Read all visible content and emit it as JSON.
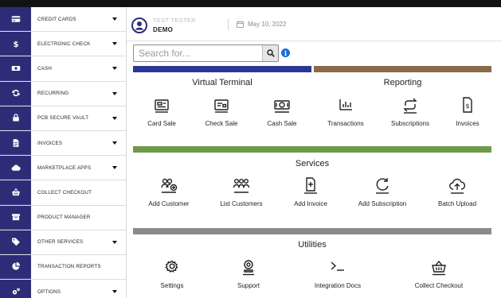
{
  "sidebar": {
    "items": [
      {
        "label": "CREDIT CARDS",
        "icon": "credit-card-icon",
        "caret": true
      },
      {
        "label": "ELECTRONIC CHECK",
        "icon": "dollar-icon",
        "caret": true
      },
      {
        "label": "CASH",
        "icon": "cash-icon",
        "caret": true
      },
      {
        "label": "RECURRING",
        "icon": "recurring-icon",
        "caret": true
      },
      {
        "label": "PCB SECURE VAULT",
        "icon": "lock-icon",
        "caret": true
      },
      {
        "label": "INVOICES",
        "icon": "invoice-icon",
        "caret": true
      },
      {
        "label": "MARKETPLACE APPS",
        "icon": "cloud-icon",
        "caret": true
      },
      {
        "label": "COLLECT CHECKOUT",
        "icon": "basket-icon",
        "caret": false
      },
      {
        "label": "PRODUCT MANAGER",
        "icon": "box-icon",
        "caret": false
      },
      {
        "label": "OTHER SERVICES",
        "icon": "tags-icon",
        "caret": true
      },
      {
        "label": "TRANSACTION REPORTS",
        "icon": "pie-chart-icon",
        "caret": false
      },
      {
        "label": "OPTIONS",
        "icon": "gears-icon",
        "caret": true
      }
    ]
  },
  "header": {
    "user_top": "TEST TESTER",
    "user_name": "DEMO",
    "date": "May 10, 2022"
  },
  "search": {
    "placeholder": "Search for..."
  },
  "panels": {
    "virtual_terminal": {
      "title": "Virtual Terminal",
      "color": "#2a3794",
      "tiles": [
        {
          "label": "Card Sale",
          "icon": "card-sale-icon"
        },
        {
          "label": "Check Sale",
          "icon": "check-sale-icon"
        },
        {
          "label": "Cash Sale",
          "icon": "cash-sale-icon"
        }
      ]
    },
    "reporting": {
      "title": "Reporting",
      "color": "#8b6a4a",
      "tiles": [
        {
          "label": "Transactions",
          "icon": "bar-chart-icon"
        },
        {
          "label": "Subscriptions",
          "icon": "repeat-icon"
        },
        {
          "label": "Invoices",
          "icon": "invoice-dollar-icon"
        }
      ]
    },
    "services": {
      "title": "Services",
      "color": "#6e9a4a",
      "tiles": [
        {
          "label": "Add Customer",
          "icon": "add-customer-icon"
        },
        {
          "label": "List Customers",
          "icon": "list-customers-icon"
        },
        {
          "label": "Add Invoice",
          "icon": "add-invoice-icon"
        },
        {
          "label": "Add Subscription",
          "icon": "add-subscription-icon"
        },
        {
          "label": "Batch Upload",
          "icon": "cloud-upload-icon"
        }
      ]
    },
    "utilities": {
      "title": "Utilities",
      "color": "#8a8a8a",
      "tiles": [
        {
          "label": "Settings",
          "icon": "gear-icon"
        },
        {
          "label": "Support",
          "icon": "support-icon"
        },
        {
          "label": "Integration Docs",
          "icon": "terminal-icon"
        },
        {
          "label": "Collect Checkout",
          "icon": "checkout-basket-icon"
        }
      ]
    }
  }
}
